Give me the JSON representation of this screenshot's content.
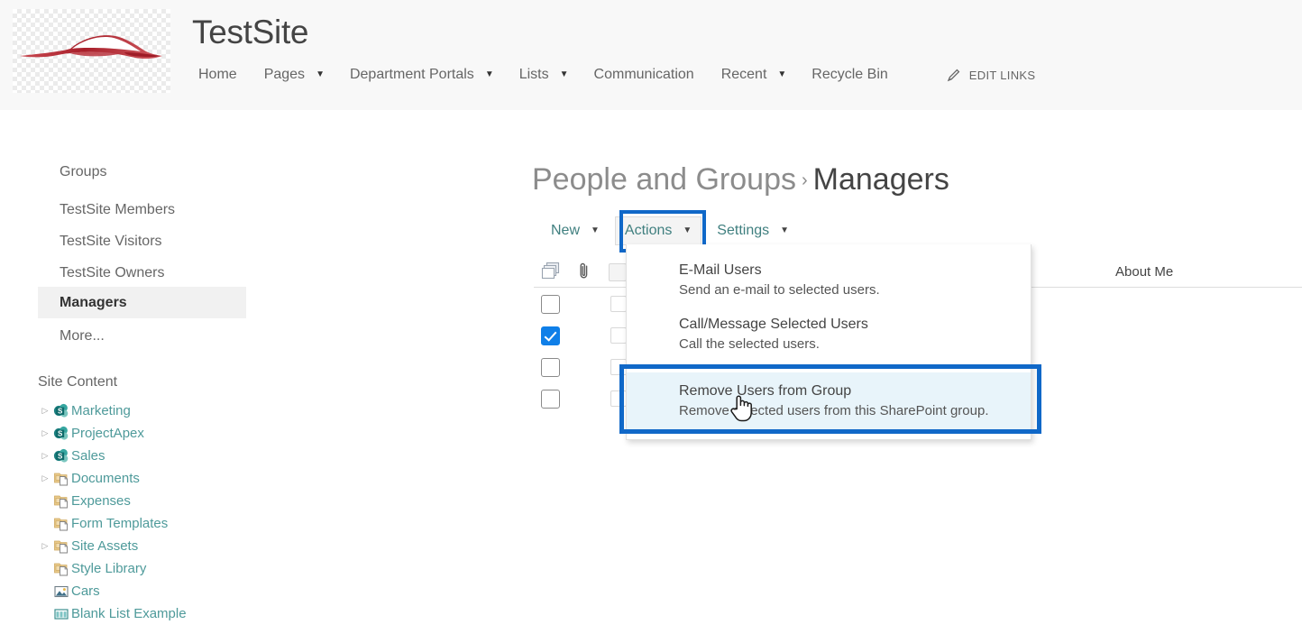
{
  "header": {
    "site_title": "TestSite",
    "logo_icon": "sports-car-logo",
    "nav_items": [
      {
        "label": "Home",
        "has_caret": false
      },
      {
        "label": "Pages",
        "has_caret": true
      },
      {
        "label": "Department Portals",
        "has_caret": true
      },
      {
        "label": "Lists",
        "has_caret": true
      },
      {
        "label": "Communication",
        "has_caret": false
      },
      {
        "label": "Recent",
        "has_caret": true
      },
      {
        "label": "Recycle Bin",
        "has_caret": false
      }
    ],
    "edit_links": {
      "label": "EDIT LINKS",
      "icon": "pencil-icon"
    }
  },
  "left_nav": {
    "groups_heading": "Groups",
    "groups": [
      {
        "label": "TestSite Members",
        "selected": false
      },
      {
        "label": "TestSite Visitors",
        "selected": false
      },
      {
        "label": "TestSite Owners",
        "selected": false
      },
      {
        "label": "Managers",
        "selected": true
      },
      {
        "label": "More...",
        "selected": false
      }
    ],
    "site_content_heading": "Site Content",
    "tree": [
      {
        "label": "Marketing",
        "icon": "sharepoint-site-icon",
        "expandable": true
      },
      {
        "label": "ProjectApex",
        "icon": "sharepoint-site-icon",
        "expandable": true
      },
      {
        "label": "Sales",
        "icon": "sharepoint-site-icon",
        "expandable": true
      },
      {
        "label": "Documents",
        "icon": "document-library-icon",
        "expandable": true
      },
      {
        "label": "Expenses",
        "icon": "document-library-icon",
        "expandable": false
      },
      {
        "label": "Form Templates",
        "icon": "document-library-icon",
        "expandable": false
      },
      {
        "label": "Site Assets",
        "icon": "document-library-icon",
        "expandable": true
      },
      {
        "label": "Style Library",
        "icon": "document-library-icon",
        "expandable": false
      },
      {
        "label": "Cars",
        "icon": "picture-library-icon",
        "expandable": false
      },
      {
        "label": "Blank List Example",
        "icon": "list-icon",
        "expandable": false
      }
    ]
  },
  "main": {
    "breadcrumb_root": "People and Groups",
    "breadcrumb_separator": "›",
    "breadcrumb_current": "Managers",
    "toolbar": [
      {
        "label": "New",
        "state": "normal"
      },
      {
        "label": "Actions",
        "state": "open"
      },
      {
        "label": "Settings",
        "state": "normal"
      }
    ],
    "table": {
      "select_all_icon": "select-all-icon",
      "attachment_icon": "paperclip-icon",
      "about_me_header": "About Me",
      "rows": [
        {
          "selected": false
        },
        {
          "selected": true
        },
        {
          "selected": false
        },
        {
          "selected": false
        }
      ]
    },
    "actions_menu": [
      {
        "title": "E-Mail Users",
        "description": "Send an e-mail to selected users.",
        "hovered": false
      },
      {
        "title": "Call/Message Selected Users",
        "description": "Call the selected users.",
        "hovered": false
      },
      {
        "title": "Remove Users from Group",
        "description": "Remove selected users from this SharePoint group.",
        "hovered": true
      }
    ]
  },
  "annotations": {
    "highlight_color": "#1068c8",
    "actions_button_box": "actions-button-highlight",
    "remove-users_box": "remove-users-menu-item-highlight",
    "cursor": "hand-pointer-cursor"
  }
}
